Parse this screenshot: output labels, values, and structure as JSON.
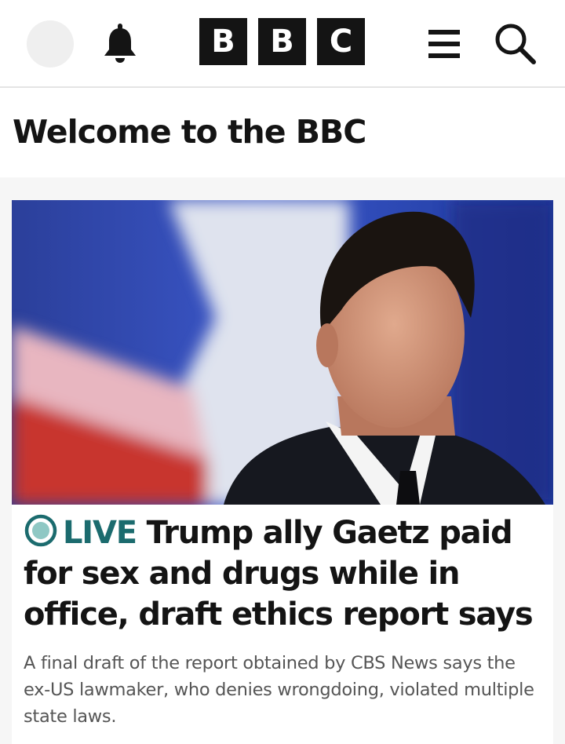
{
  "header": {
    "logo_letters": [
      "B",
      "B",
      "C"
    ],
    "icons": [
      "avatar",
      "bell-icon",
      "bbc-logo",
      "menu-icon",
      "search-icon"
    ]
  },
  "welcome": {
    "title": "Welcome to the BBC"
  },
  "story": {
    "live_label": "LIVE",
    "headline": "Trump ally Gaetz paid for sex and drugs while in office, draft ethics report says",
    "summary": "A final draft of the report obtained by CBS News says the ex-US lawmaker, who denies wrongdoing, violated multiple state laws."
  },
  "colors": {
    "live": "#1b6b6e",
    "text": "#141414",
    "summary_text": "#555555",
    "background": "#f6f6f6"
  }
}
